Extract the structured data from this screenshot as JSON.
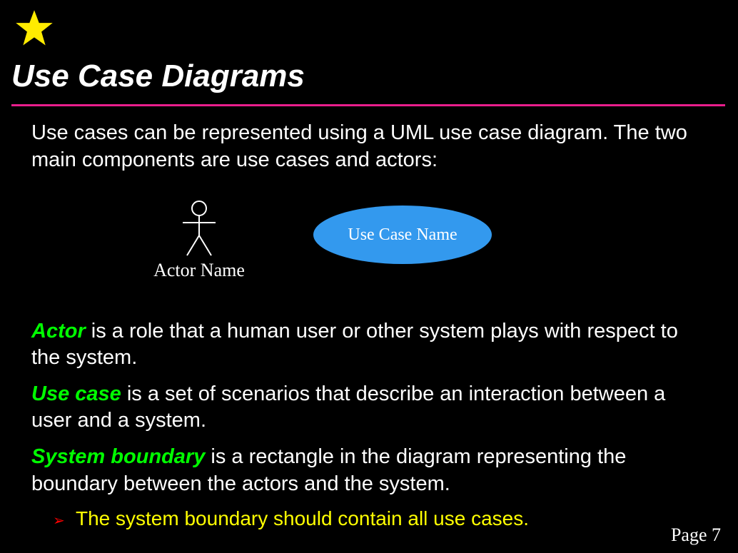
{
  "title": "Use Case Diagrams",
  "intro": "Use cases can be represented using a UML use case diagram. The two main components are use cases and actors:",
  "diagram": {
    "actor_label": "Actor Name",
    "usecase_label": "Use Case Name"
  },
  "definitions": [
    {
      "term": "Actor",
      "text": " is a role that a human user or other system plays with respect to the system."
    },
    {
      "term": "Use case",
      "text": " is a set of scenarios that describe an interaction between a user and a system."
    },
    {
      "term": "System boundary",
      "text": " is a rectangle in the diagram representing the boundary between the actors and the system."
    }
  ],
  "sub_bullet": "The system boundary should contain all use cases.",
  "page_number": "Page 7"
}
